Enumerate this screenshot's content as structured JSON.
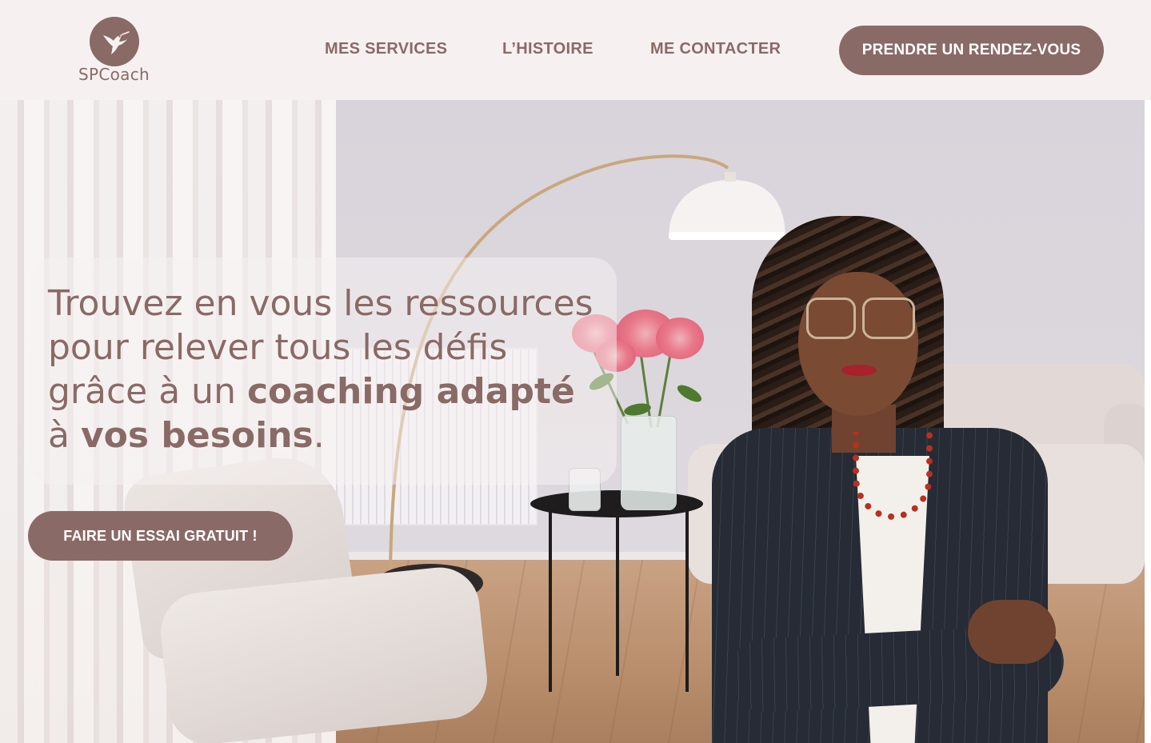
{
  "brand": {
    "name": "SPCoach",
    "logo_icon": "hummingbird-icon",
    "color": "#8a6a66",
    "header_background": "#f6f1f0"
  },
  "nav": {
    "items": [
      {
        "label": "MES SERVICES"
      },
      {
        "label": "L’HISTOIRE"
      },
      {
        "label": "ME CONTACTER"
      }
    ],
    "cta_label": "PRENDRE UN RENDEZ-VOUS"
  },
  "hero": {
    "headline": {
      "line1": "Trouvez en vous les ressources",
      "line2": "pour relever tous les défis",
      "line3_prefix": "grâce à un ",
      "line3_bold": "coaching adapté",
      "line4_prefix": "à ",
      "line4_bold": "vos besoins",
      "line4_suffix": "."
    },
    "cta_label": "FAIRE UN ESSAI GRATUIT !",
    "image": "coach-portrait-living-room"
  }
}
